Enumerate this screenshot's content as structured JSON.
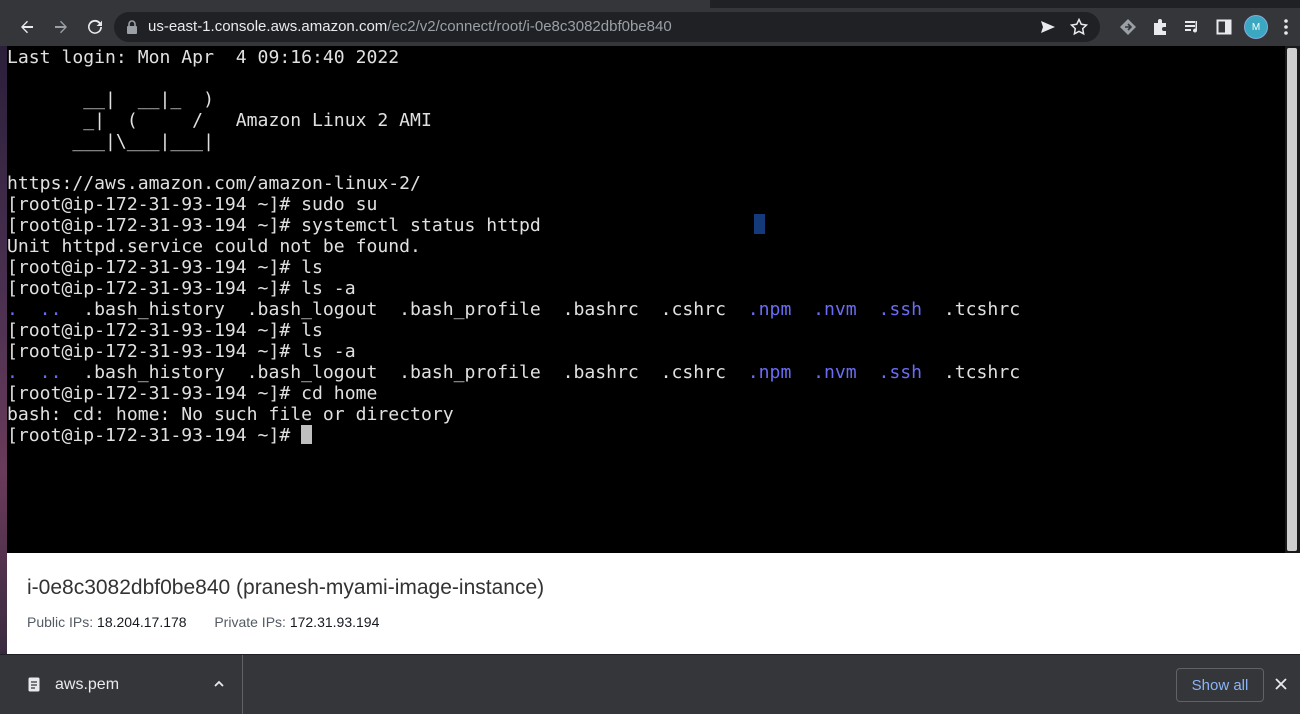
{
  "browser": {
    "url_host": "us-east-1.console.aws.amazon.com",
    "url_path": "/ec2/v2/connect/root/i-0e8c3082dbf0be840",
    "icons": [
      "back-icon",
      "forward-icon",
      "reload-icon",
      "lock-icon",
      "send-icon",
      "star-icon",
      "extension-icon",
      "puzzle-icon",
      "media-icon",
      "sidepanel-icon",
      "avatar",
      "menu-icon"
    ]
  },
  "terminal": {
    "lines": [
      [
        {
          "t": "Last login: Mon Apr  4 09:16:40 2022"
        }
      ],
      [
        {
          "t": ""
        }
      ],
      [
        {
          "t": "       __|  __|_  )"
        }
      ],
      [
        {
          "t": "       _|  (     /   Amazon Linux 2 AMI"
        }
      ],
      [
        {
          "t": "      ___|\\___|___|"
        }
      ],
      [
        {
          "t": ""
        }
      ],
      [
        {
          "t": "https://aws.amazon.com/amazon-linux-2/"
        }
      ],
      [
        {
          "t": "[root@ip-172-31-93-194 ~]# sudo su"
        }
      ],
      [
        {
          "t": "[root@ip-172-31-93-194 ~]# systemctl status httpd"
        }
      ],
      [
        {
          "t": "Unit httpd.service could not be found."
        }
      ],
      [
        {
          "t": "[root@ip-172-31-93-194 ~]# ls"
        }
      ],
      [
        {
          "t": "[root@ip-172-31-93-194 ~]# ls -a"
        }
      ],
      [
        {
          "t": ".  ..",
          "c": "blue"
        },
        {
          "t": "  .bash_history  .bash_logout  .bash_profile  .bashrc  .cshrc  "
        },
        {
          "t": ".npm  .nvm  .ssh",
          "c": "blue"
        },
        {
          "t": "  .tcshrc"
        }
      ],
      [
        {
          "t": "[root@ip-172-31-93-194 ~]# ls"
        }
      ],
      [
        {
          "t": "[root@ip-172-31-93-194 ~]# ls -a"
        }
      ],
      [
        {
          "t": ".  ..",
          "c": "blue"
        },
        {
          "t": "  .bash_history  .bash_logout  .bash_profile  .bashrc  .cshrc  "
        },
        {
          "t": ".npm  .nvm  .ssh",
          "c": "blue"
        },
        {
          "t": "  .tcshrc"
        }
      ],
      [
        {
          "t": "[root@ip-172-31-93-194 ~]# cd home"
        }
      ],
      [
        {
          "t": "bash: cd: home: No such file or directory"
        }
      ],
      [
        {
          "t": "[root@ip-172-31-93-194 ~]# "
        },
        {
          "cursor": true
        }
      ]
    ]
  },
  "instance": {
    "title": "i-0e8c3082dbf0be840 (pranesh-myami-image-instance)",
    "public_label": "Public IPs:",
    "public_ip": "18.204.17.178",
    "private_label": "Private IPs:",
    "private_ip": "172.31.93.194"
  },
  "downloads": {
    "file_name": "aws.pem",
    "show_all": "Show all"
  }
}
